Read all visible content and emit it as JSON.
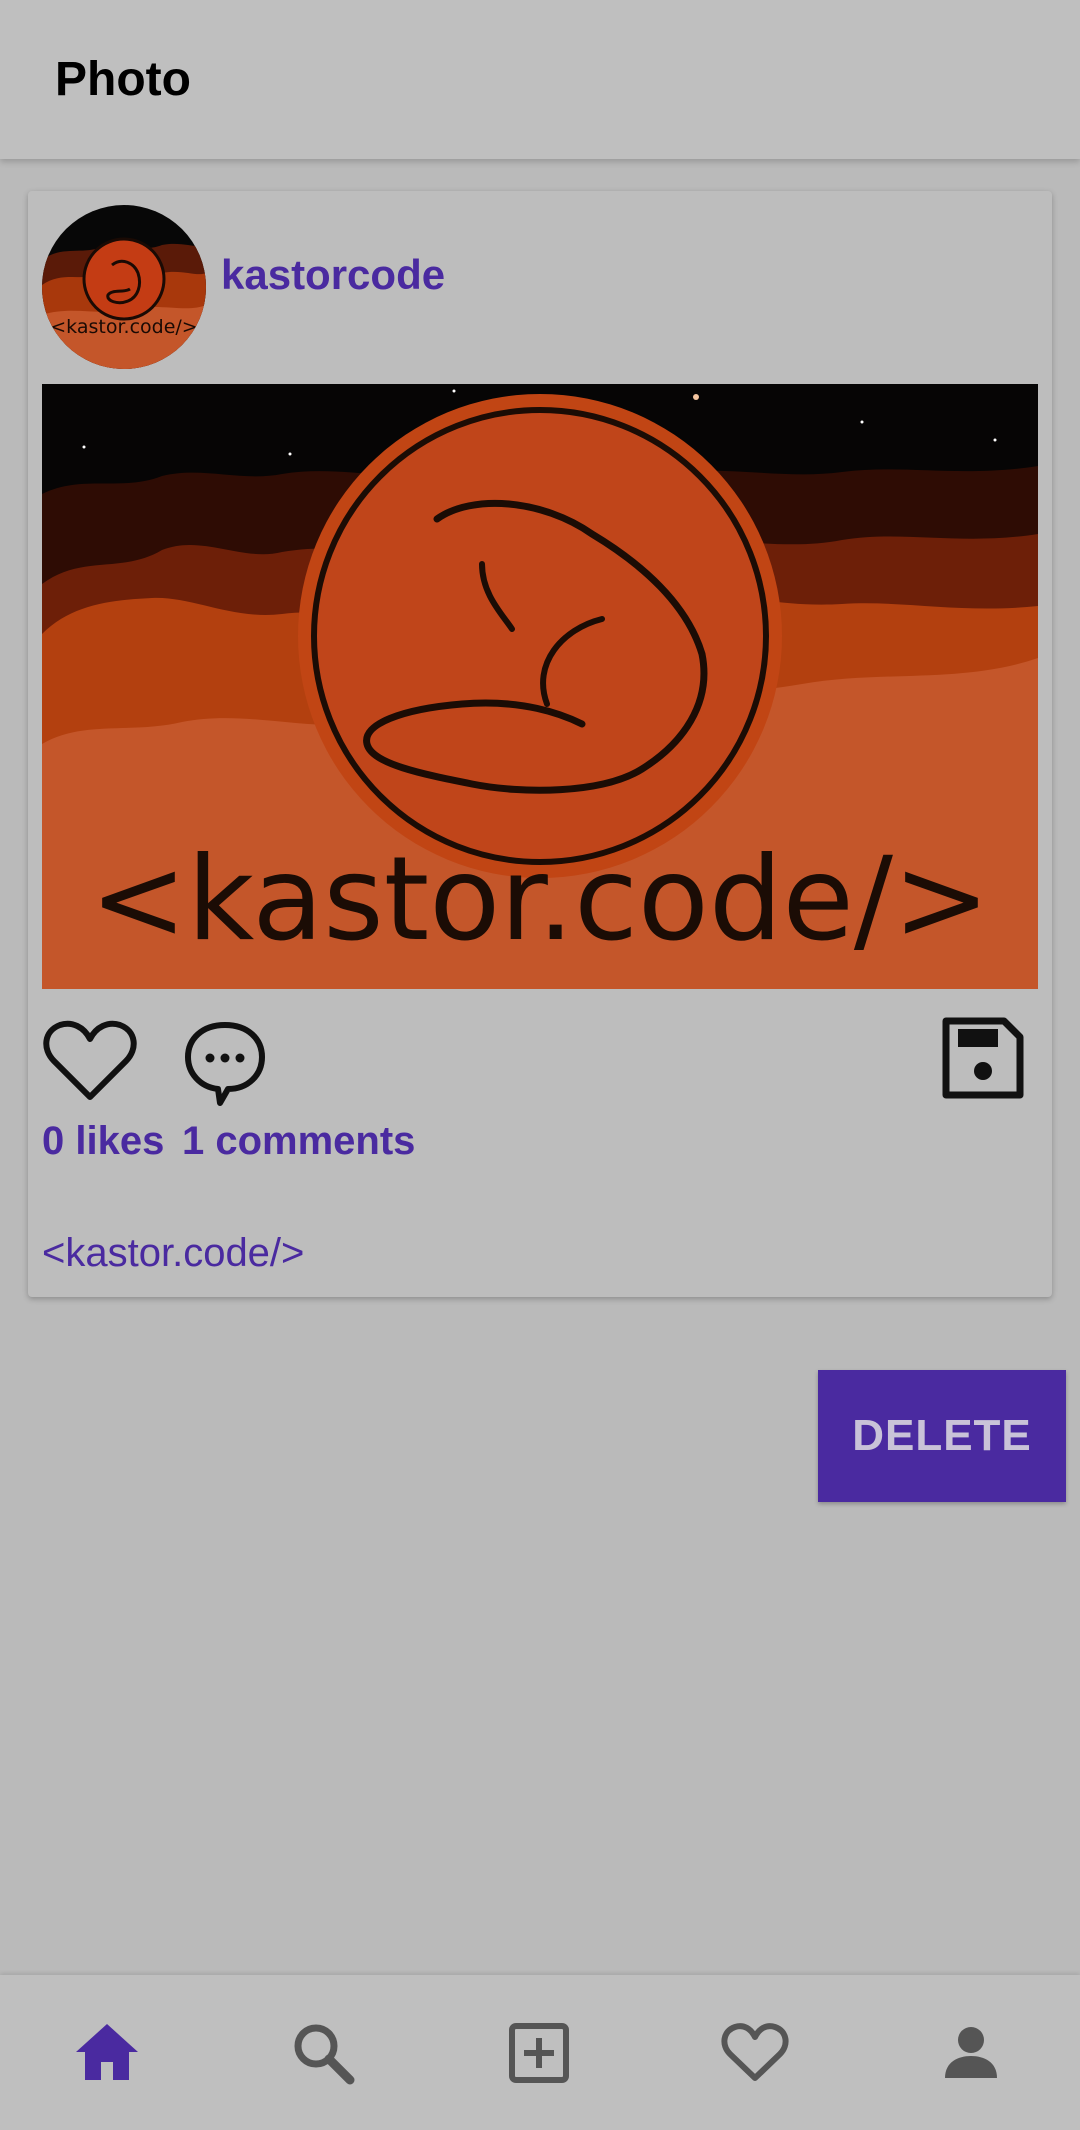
{
  "header": {
    "title": "Photo"
  },
  "post": {
    "username": "kastorcode",
    "avatar_text": "<kastor.code/>",
    "image_text": "<kastor.code/>",
    "likes": "0 likes",
    "comments": "1 comments",
    "caption": "<kastor.code/>"
  },
  "actions": {
    "delete_label": "DELETE"
  },
  "bottom_nav": [
    {
      "name": "home-icon",
      "active": true
    },
    {
      "name": "search-icon",
      "active": false
    },
    {
      "name": "add-box-icon",
      "active": false
    },
    {
      "name": "heart-icon",
      "active": false
    },
    {
      "name": "person-icon",
      "active": false
    }
  ],
  "colors": {
    "accent": "#4a2aa0",
    "background": "#bababa",
    "icon_inactive": "#555555"
  }
}
